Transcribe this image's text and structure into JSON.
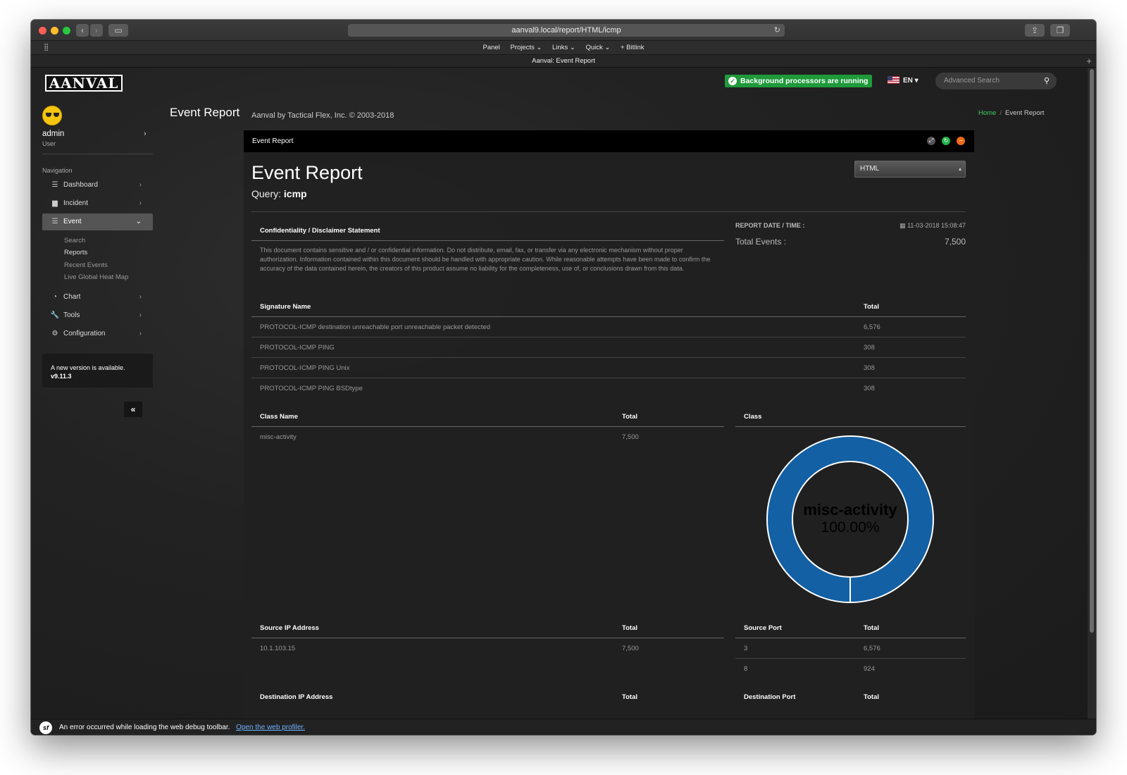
{
  "browser": {
    "url": "aanval9.local/report/HTML/icmp",
    "tab_title": "Aanval: Event Report",
    "bookmarks": [
      "Panel",
      "Projects ⌄",
      "Links ⌄",
      "Quick ⌄",
      "+ Bitlink"
    ]
  },
  "header": {
    "logo": "AANVAL",
    "status": "Background processors are running",
    "language": "EN",
    "search_placeholder": "Advanced Search"
  },
  "user": {
    "name": "admin",
    "role": "User"
  },
  "sidebar": {
    "heading": "Navigation",
    "items": [
      {
        "label": "Dashboard"
      },
      {
        "label": "Incident"
      },
      {
        "label": "Event"
      },
      {
        "label": "Chart"
      },
      {
        "label": "Tools"
      },
      {
        "label": "Configuration"
      }
    ],
    "event_sub": [
      "Search",
      "Reports",
      "Recent Events",
      "Live Global Heat Map"
    ],
    "update_line1": "A new version is available.",
    "update_line2": "v9.11.3"
  },
  "page": {
    "title": "Event Report",
    "subtitle": "Aanval by Tactical Flex, Inc. © 2003-2018",
    "breadcrumb_home": "Home",
    "breadcrumb_current": "Event Report"
  },
  "panel": {
    "header": "Event Report",
    "report_title": "Event Report",
    "query_label": "Query:",
    "query_value": "icmp",
    "format": "HTML",
    "disclaimer_title": "Confidentiality / Disclaimer Statement",
    "disclaimer_text": "This document contains sensitive and / or confidential information. Do not distribute, email, fax, or transfer via any electronic mechanism without proper authorization. Information contained within this document should be handled with appropriate caution. While reasonable attempts have been made to confirm the accuracy of the data contained herein, the creators of this product assume no liability for the completeness, use of, or conclusions drawn from this data.",
    "report_date_label": "REPORT DATE / TIME :",
    "report_date_value": "11-03-2018 15:08:47",
    "total_events_label": "Total Events :",
    "total_events_value": "7,500"
  },
  "signatures": {
    "headers": [
      "Signature Name",
      "Total"
    ],
    "rows": [
      [
        "PROTOCOL-ICMP destination unreachable port unreachable packet detected",
        "6,576"
      ],
      [
        "PROTOCOL-ICMP PING",
        "308"
      ],
      [
        "PROTOCOL-ICMP PING Unix",
        "308"
      ],
      [
        "PROTOCOL-ICMP PING BSDtype",
        "308"
      ]
    ]
  },
  "classes": {
    "headers": [
      "Class Name",
      "Total"
    ],
    "rows": [
      [
        "misc-activity",
        "7,500"
      ]
    ],
    "chart_header": "Class"
  },
  "chart_data": {
    "type": "pie",
    "title": "",
    "categories": [
      "misc-activity"
    ],
    "values": [
      100.0
    ],
    "labels": [
      "misc-activity",
      "100.00%"
    ],
    "colors": [
      "#1360a4"
    ]
  },
  "source_ip": {
    "headers": [
      "Source IP Address",
      "Total"
    ],
    "rows": [
      [
        "10.1.103.15",
        "7,500"
      ]
    ]
  },
  "source_port": {
    "headers": [
      "Source Port",
      "Total"
    ],
    "rows": [
      [
        "3",
        "6,576"
      ],
      [
        "8",
        "924"
      ]
    ]
  },
  "destination": {
    "ip_headers": [
      "Destination IP Address",
      "Total"
    ],
    "port_headers": [
      "Destination Port",
      "Total"
    ]
  },
  "debug_bar": {
    "message": "An error occurred while loading the web debug toolbar.",
    "link": "Open the web profiler."
  }
}
